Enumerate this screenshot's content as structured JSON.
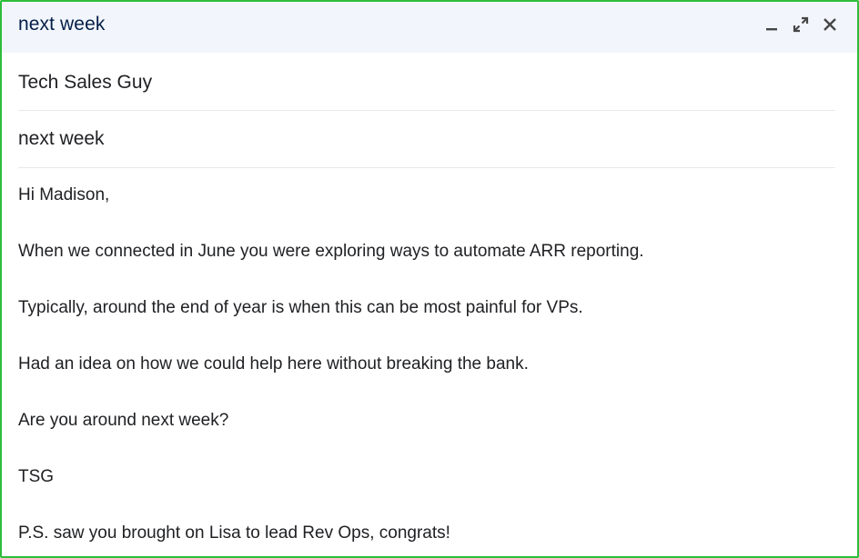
{
  "window": {
    "title": "next week",
    "controls": {
      "minimize_icon": "minimize-icon",
      "popout_icon": "expand-icon",
      "close_icon": "close-icon"
    }
  },
  "fields": {
    "to_value": "Tech Sales Guy",
    "subject_value": "next week"
  },
  "message": {
    "lines": [
      "Hi Madison,",
      "When we connected in June you were exploring ways to automate ARR reporting.",
      "Typically, around the end of year is when this can be most painful for VPs.",
      "Had an idea on how we could help here without breaking the bank.",
      "Are you around next week?",
      "TSG",
      "P.S. saw you brought on Lisa to lead Rev Ops, congrats!"
    ]
  },
  "colors": {
    "border": "#2ebd3a",
    "titlebar_bg": "#f2f6fc",
    "title_text": "#041e49"
  }
}
